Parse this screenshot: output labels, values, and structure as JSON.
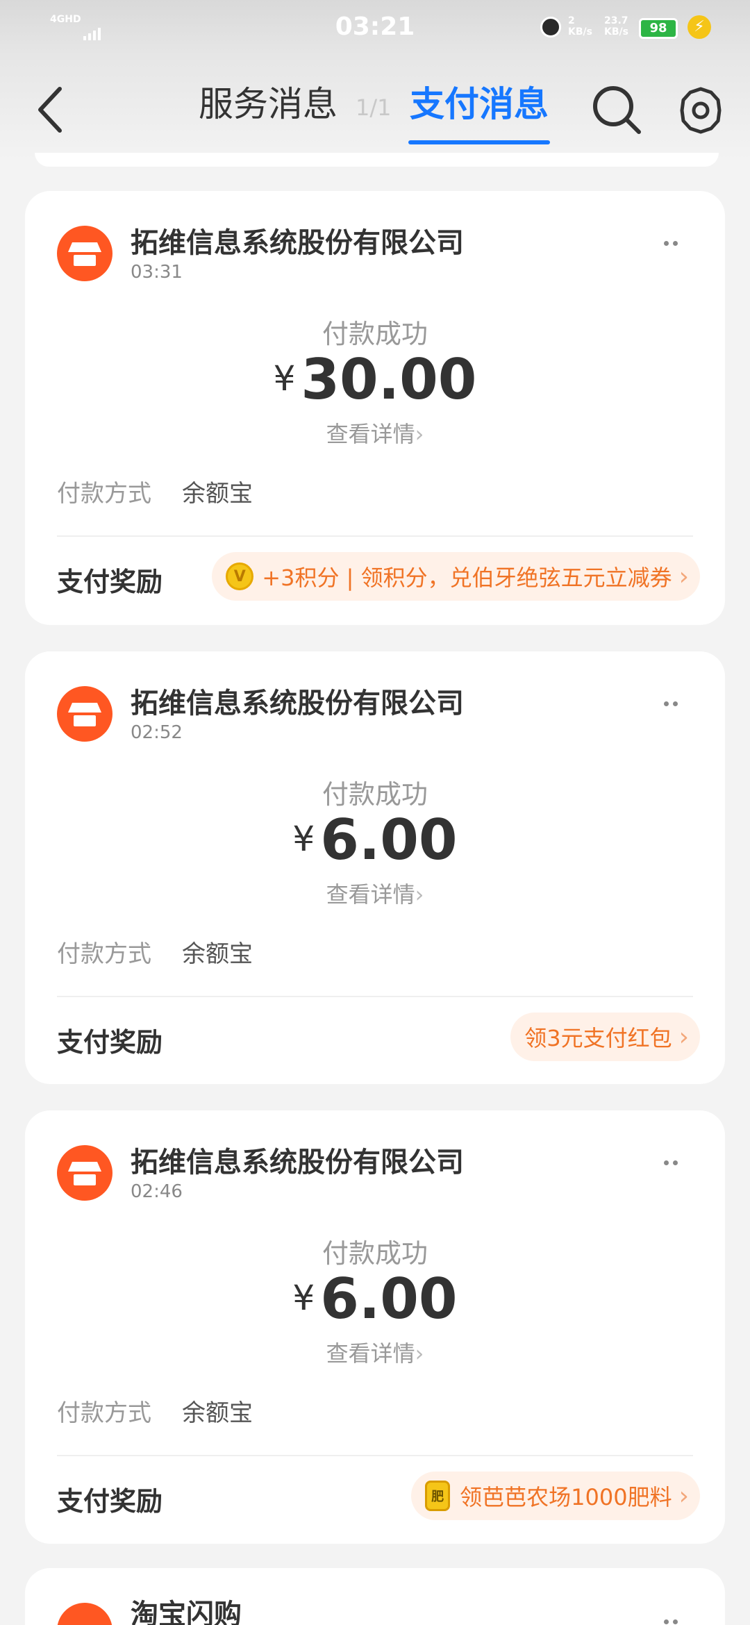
{
  "status_bar": {
    "network": "4GHD",
    "time": "03:21",
    "speed_top": "2",
    "speed_unit": "KB/s",
    "speed2": "23.7",
    "speed2_unit": "KB/s",
    "battery": "98"
  },
  "header": {
    "tab_service": "服务消息",
    "page_indicator": "1/1",
    "tab_payment": "支付消息",
    "active_tab": "支付消息",
    "accent_color": "#1677ff"
  },
  "cards": [
    {
      "merchant": "拓维信息系统股份有限公司",
      "time": "03:31",
      "status": "付款成功",
      "currency": "¥",
      "amount": "30.00",
      "detail": "查看详情",
      "method_label": "付款方式",
      "method": "余额宝",
      "reward_label": "支付奖励",
      "reward_icon": "gold-coin-icon",
      "reward": "+3积分 | 领积分，兑伯牙绝弦五元立减券"
    },
    {
      "merchant": "拓维信息系统股份有限公司",
      "time": "02:52",
      "status": "付款成功",
      "currency": "¥",
      "amount": "6.00",
      "detail": "查看详情",
      "method_label": "付款方式",
      "method": "余额宝",
      "reward_label": "支付奖励",
      "reward": "领3元支付红包"
    },
    {
      "merchant": "拓维信息系统股份有限公司",
      "time": "02:46",
      "status": "付款成功",
      "currency": "¥",
      "amount": "6.00",
      "detail": "查看详情",
      "method_label": "付款方式",
      "method": "余额宝",
      "reward_label": "支付奖励",
      "reward_icon": "fertilizer-bag-icon",
      "reward_icon_text": "肥",
      "reward": "领芭芭农场1000肥料"
    },
    {
      "merchant": "淘宝闪购"
    }
  ],
  "colors": {
    "merchant_logo": "#ff5722",
    "reward_text": "#f07325",
    "reward_bg": "#fff1e8"
  }
}
